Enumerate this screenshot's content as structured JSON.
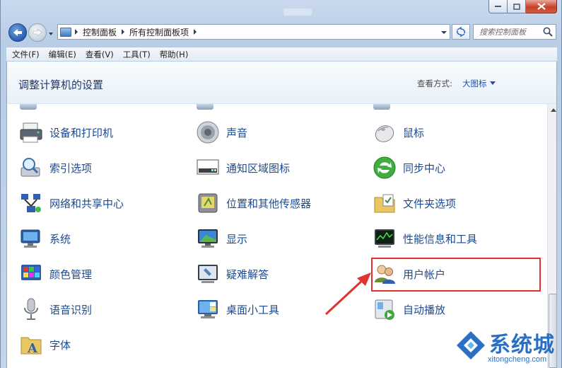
{
  "window": {
    "caption_buttons": [
      "minimize",
      "maximize",
      "close"
    ]
  },
  "address_bar": {
    "breadcrumbs": [
      "控制面板",
      "所有控制面板项"
    ]
  },
  "search": {
    "placeholder": "搜索控制面板"
  },
  "menu": {
    "items": [
      "文件(F)",
      "编辑(E)",
      "查看(V)",
      "工具(T)",
      "帮助(H)"
    ]
  },
  "header": {
    "title": "调整计算机的设置",
    "view_label": "查看方式:",
    "view_value": "大图标"
  },
  "items": [
    {
      "label": "设备和打印机",
      "icon": "printer-icon"
    },
    {
      "label": "声音",
      "icon": "speaker-icon"
    },
    {
      "label": "鼠标",
      "icon": "mouse-icon"
    },
    {
      "label": "索引选项",
      "icon": "index-magnifier-icon"
    },
    {
      "label": "通知区域图标",
      "icon": "taskbar-notify-icon"
    },
    {
      "label": "同步中心",
      "icon": "sync-icon"
    },
    {
      "label": "网络和共享中心",
      "icon": "network-icon"
    },
    {
      "label": "位置和其他传感器",
      "icon": "location-sensor-icon"
    },
    {
      "label": "文件夹选项",
      "icon": "folder-options-icon"
    },
    {
      "label": "系统",
      "icon": "system-computer-icon"
    },
    {
      "label": "显示",
      "icon": "display-monitor-icon"
    },
    {
      "label": "性能信息和工具",
      "icon": "performance-meter-icon"
    },
    {
      "label": "颜色管理",
      "icon": "color-management-icon"
    },
    {
      "label": "疑难解答",
      "icon": "troubleshoot-icon"
    },
    {
      "label": "用户帐户",
      "icon": "user-accounts-icon"
    },
    {
      "label": "语音识别",
      "icon": "microphone-icon"
    },
    {
      "label": "桌面小工具",
      "icon": "desktop-gadgets-icon"
    },
    {
      "label": "自动播放",
      "icon": "autoplay-icon"
    },
    {
      "label": "字体",
      "icon": "fonts-icon"
    }
  ],
  "annotation": {
    "highlighted_item": "用户帐户",
    "color": "#e0322f"
  },
  "watermark": {
    "name": "系统城",
    "domain": "xitongcheng.com"
  }
}
